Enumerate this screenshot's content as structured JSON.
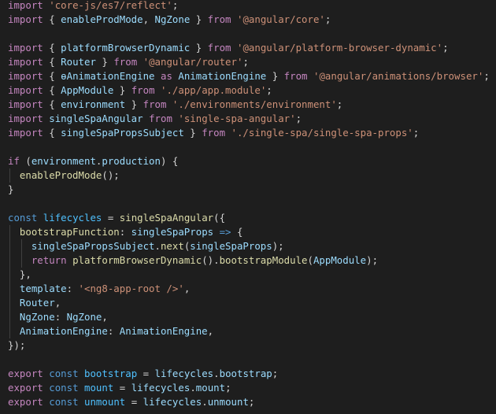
{
  "editor": {
    "lines": [
      [
        [
          "kw",
          "import"
        ],
        [
          "pu",
          " "
        ],
        [
          "st",
          "'core-js/es7/reflect'"
        ],
        [
          "pu",
          ";"
        ]
      ],
      [
        [
          "kw",
          "import"
        ],
        [
          "pu",
          " { "
        ],
        [
          "va",
          "enableProdMode"
        ],
        [
          "pu",
          ", "
        ],
        [
          "va",
          "NgZone"
        ],
        [
          "pu",
          " } "
        ],
        [
          "kw",
          "from"
        ],
        [
          "pu",
          " "
        ],
        [
          "st",
          "'@angular/core'"
        ],
        [
          "pu",
          ";"
        ]
      ],
      [],
      [
        [
          "kw",
          "import"
        ],
        [
          "pu",
          " { "
        ],
        [
          "va",
          "platformBrowserDynamic"
        ],
        [
          "pu",
          " } "
        ],
        [
          "kw",
          "from"
        ],
        [
          "pu",
          " "
        ],
        [
          "st",
          "'@angular/platform-browser-dynamic'"
        ],
        [
          "pu",
          ";"
        ]
      ],
      [
        [
          "kw",
          "import"
        ],
        [
          "pu",
          " { "
        ],
        [
          "va",
          "Router"
        ],
        [
          "pu",
          " } "
        ],
        [
          "kw",
          "from"
        ],
        [
          "pu",
          " "
        ],
        [
          "st",
          "'@angular/router'"
        ],
        [
          "pu",
          ";"
        ]
      ],
      [
        [
          "kw",
          "import"
        ],
        [
          "pu",
          " { "
        ],
        [
          "va",
          "ɵAnimationEngine"
        ],
        [
          "pu",
          " "
        ],
        [
          "kw",
          "as"
        ],
        [
          "pu",
          " "
        ],
        [
          "va",
          "AnimationEngine"
        ],
        [
          "pu",
          " } "
        ],
        [
          "kw",
          "from"
        ],
        [
          "pu",
          " "
        ],
        [
          "st",
          "'@angular/animations/browser'"
        ],
        [
          "pu",
          ";"
        ]
      ],
      [
        [
          "kw",
          "import"
        ],
        [
          "pu",
          " { "
        ],
        [
          "va",
          "AppModule"
        ],
        [
          "pu",
          " } "
        ],
        [
          "kw",
          "from"
        ],
        [
          "pu",
          " "
        ],
        [
          "st",
          "'./app/app.module'"
        ],
        [
          "pu",
          ";"
        ]
      ],
      [
        [
          "kw",
          "import"
        ],
        [
          "pu",
          " { "
        ],
        [
          "va",
          "environment"
        ],
        [
          "pu",
          " } "
        ],
        [
          "kw",
          "from"
        ],
        [
          "pu",
          " "
        ],
        [
          "st",
          "'./environments/environment'"
        ],
        [
          "pu",
          ";"
        ]
      ],
      [
        [
          "kw",
          "import"
        ],
        [
          "pu",
          " "
        ],
        [
          "va",
          "singleSpaAngular"
        ],
        [
          "pu",
          " "
        ],
        [
          "kw",
          "from"
        ],
        [
          "pu",
          " "
        ],
        [
          "st",
          "'single-spa-angular'"
        ],
        [
          "pu",
          ";"
        ]
      ],
      [
        [
          "kw",
          "import"
        ],
        [
          "pu",
          " { "
        ],
        [
          "va",
          "singleSpaPropsSubject"
        ],
        [
          "pu",
          " } "
        ],
        [
          "kw",
          "from"
        ],
        [
          "pu",
          " "
        ],
        [
          "st",
          "'./single-spa/single-spa-props'"
        ],
        [
          "pu",
          ";"
        ]
      ],
      [],
      [
        [
          "kw",
          "if"
        ],
        [
          "pu",
          " ("
        ],
        [
          "va",
          "environment"
        ],
        [
          "pu",
          "."
        ],
        [
          "va",
          "production"
        ],
        [
          "pu",
          ") {"
        ]
      ],
      [
        [
          "pu",
          "  "
        ],
        [
          "fn",
          "enableProdMode"
        ],
        [
          "pu",
          "();"
        ]
      ],
      [
        [
          "pu",
          "}"
        ]
      ],
      [],
      [
        [
          "dc",
          "const"
        ],
        [
          "pu",
          " "
        ],
        [
          "co",
          "lifecycles"
        ],
        [
          "pu",
          " = "
        ],
        [
          "fn",
          "singleSpaAngular"
        ],
        [
          "pu",
          "({"
        ]
      ],
      [
        [
          "pu",
          "  "
        ],
        [
          "fn",
          "bootstrapFunction"
        ],
        [
          "pu",
          ": "
        ],
        [
          "va",
          "singleSpaProps"
        ],
        [
          "pu",
          " "
        ],
        [
          "dc",
          "=>"
        ],
        [
          "pu",
          " {"
        ]
      ],
      [
        [
          "pu",
          "    "
        ],
        [
          "va",
          "singleSpaPropsSubject"
        ],
        [
          "pu",
          "."
        ],
        [
          "fn",
          "next"
        ],
        [
          "pu",
          "("
        ],
        [
          "va",
          "singleSpaProps"
        ],
        [
          "pu",
          ");"
        ]
      ],
      [
        [
          "pu",
          "    "
        ],
        [
          "kw",
          "return"
        ],
        [
          "pu",
          " "
        ],
        [
          "fn",
          "platformBrowserDynamic"
        ],
        [
          "pu",
          "()."
        ],
        [
          "fn",
          "bootstrapModule"
        ],
        [
          "pu",
          "("
        ],
        [
          "va",
          "AppModule"
        ],
        [
          "pu",
          ");"
        ]
      ],
      [
        [
          "pu",
          "  },"
        ]
      ],
      [
        [
          "pu",
          "  "
        ],
        [
          "va",
          "template"
        ],
        [
          "pu",
          ": "
        ],
        [
          "st",
          "'<ng8-app-root />'"
        ],
        [
          "pu",
          ","
        ]
      ],
      [
        [
          "pu",
          "  "
        ],
        [
          "va",
          "Router"
        ],
        [
          "pu",
          ","
        ]
      ],
      [
        [
          "pu",
          "  "
        ],
        [
          "va",
          "NgZone"
        ],
        [
          "pu",
          ": "
        ],
        [
          "va",
          "NgZone"
        ],
        [
          "pu",
          ","
        ]
      ],
      [
        [
          "pu",
          "  "
        ],
        [
          "va",
          "AnimationEngine"
        ],
        [
          "pu",
          ": "
        ],
        [
          "va",
          "AnimationEngine"
        ],
        [
          "pu",
          ","
        ]
      ],
      [
        [
          "pu",
          "});"
        ]
      ],
      [],
      [
        [
          "kw",
          "export"
        ],
        [
          "pu",
          " "
        ],
        [
          "dc",
          "const"
        ],
        [
          "pu",
          " "
        ],
        [
          "co",
          "bootstrap"
        ],
        [
          "pu",
          " = "
        ],
        [
          "va",
          "lifecycles"
        ],
        [
          "pu",
          "."
        ],
        [
          "va",
          "bootstrap"
        ],
        [
          "pu",
          ";"
        ]
      ],
      [
        [
          "kw",
          "export"
        ],
        [
          "pu",
          " "
        ],
        [
          "dc",
          "const"
        ],
        [
          "pu",
          " "
        ],
        [
          "co",
          "mount"
        ],
        [
          "pu",
          " = "
        ],
        [
          "va",
          "lifecycles"
        ],
        [
          "pu",
          "."
        ],
        [
          "va",
          "mount"
        ],
        [
          "pu",
          ";"
        ]
      ],
      [
        [
          "kw",
          "export"
        ],
        [
          "pu",
          " "
        ],
        [
          "dc",
          "const"
        ],
        [
          "pu",
          " "
        ],
        [
          "co",
          "unmount"
        ],
        [
          "pu",
          " = "
        ],
        [
          "va",
          "lifecycles"
        ],
        [
          "pu",
          "."
        ],
        [
          "va",
          "unmount"
        ],
        [
          "pu",
          ";"
        ]
      ]
    ]
  }
}
